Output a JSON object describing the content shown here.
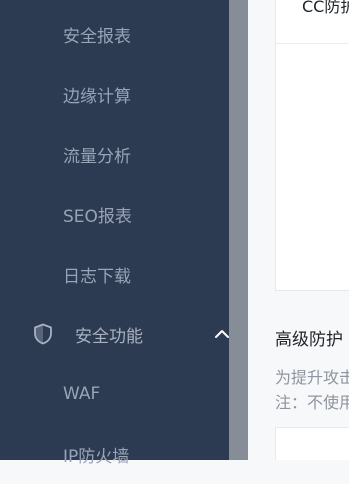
{
  "sidebar": {
    "items": [
      {
        "label": "安全报表"
      },
      {
        "label": "边缘计算"
      },
      {
        "label": "流量分析"
      },
      {
        "label": "SEO报表"
      },
      {
        "label": "日志下载"
      }
    ],
    "group": {
      "label": "安全功能",
      "icon": "shield-icon",
      "expanded": true,
      "children": [
        {
          "label": "WAF"
        },
        {
          "label": "IP防火墙"
        }
      ]
    }
  },
  "main": {
    "top_card": {
      "title": "CC防护"
    },
    "section": {
      "title": "高级防护",
      "description_line1": "为提升攻击",
      "description_line2": "注：不使用"
    }
  },
  "colors": {
    "sidebar_bg": "#2d3b52",
    "sidebar_text": "#97a3b6",
    "scrollbar": "#878d96",
    "main_bg": "#f7f8fa"
  }
}
